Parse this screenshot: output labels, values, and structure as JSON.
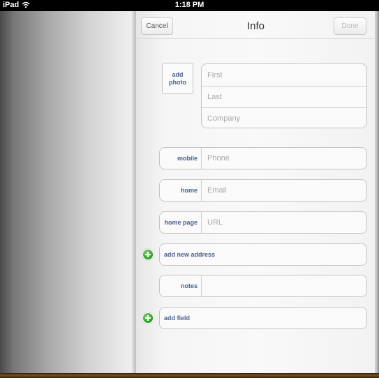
{
  "status_bar": {
    "device": "iPad",
    "time": "1:18 PM"
  },
  "nav": {
    "cancel_label": "Cancel",
    "title": "Info",
    "done_label": "Done"
  },
  "photo": {
    "line1": "add",
    "line2": "photo"
  },
  "name_fields": {
    "first": "First",
    "last": "Last",
    "company": "Company"
  },
  "fields": [
    {
      "label": "mobile",
      "placeholder": "Phone"
    },
    {
      "label": "home",
      "placeholder": "Email"
    },
    {
      "label": "home page",
      "placeholder": "URL"
    },
    {
      "label": "notes",
      "placeholder": ""
    }
  ],
  "add_rows": {
    "address": "add new address",
    "field": "add field"
  },
  "colors": {
    "label_blue": "#4d6090",
    "placeholder_gray": "#a9a9a9",
    "plus_green": "#2f9e25"
  },
  "icons": [
    "wifi-icon",
    "add-icon"
  ]
}
